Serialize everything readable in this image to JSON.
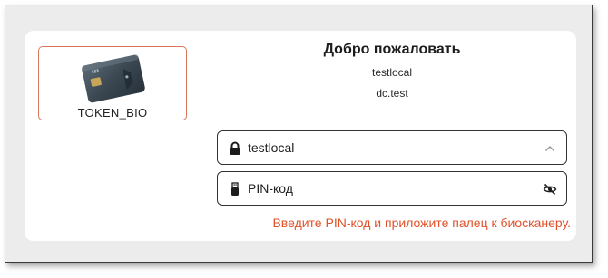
{
  "token": {
    "label": "TOKEN_BIO",
    "icon": "smart-card-icon"
  },
  "welcome": {
    "title": "Добро пожаловать",
    "user": "testlocal",
    "domain": "dc.test"
  },
  "user_field": {
    "value": "testlocal",
    "icon": "lock-icon",
    "trailing_icon": "chevron-up-icon"
  },
  "pin_field": {
    "placeholder": "PIN-код",
    "icon": "usb-token-icon",
    "trailing_icon": "eye-off-icon"
  },
  "hint": "Введите PIN-код и приложите палец к биосканеру.",
  "colors": {
    "accent": "#e0522a",
    "tile_border": "#d9775e"
  }
}
